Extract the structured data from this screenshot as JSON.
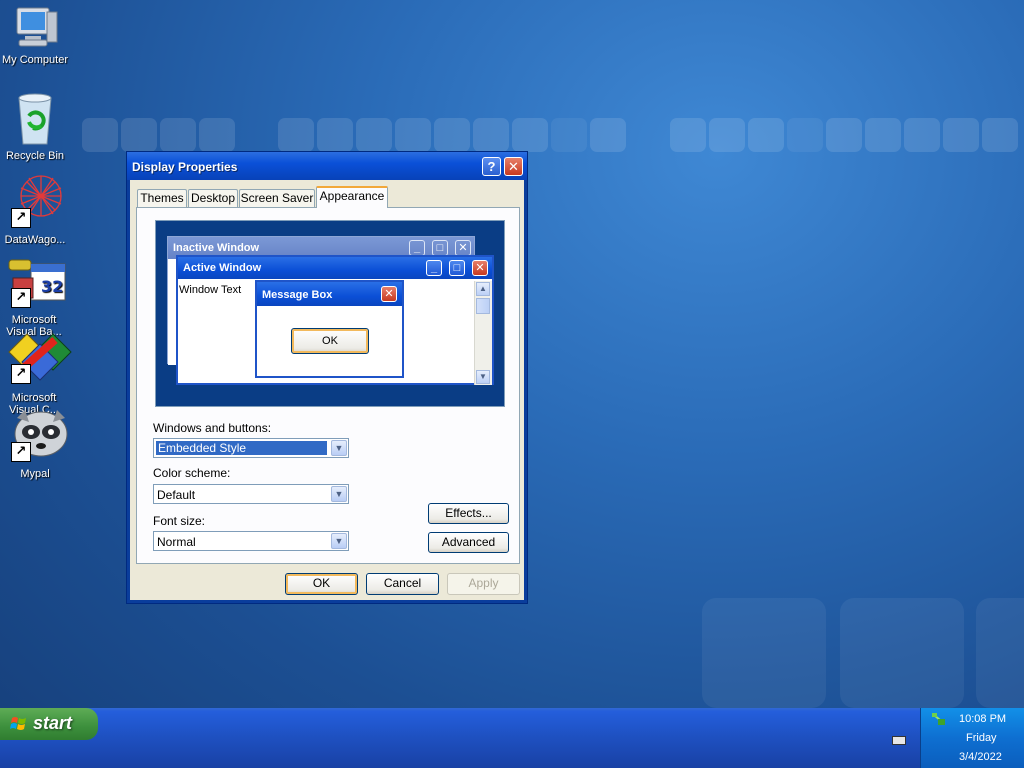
{
  "desktop": {
    "icons": [
      {
        "label": "My Computer"
      },
      {
        "label": "Recycle Bin"
      },
      {
        "label": "DataWago..."
      },
      {
        "label": "Microsoft Visual Ba..."
      },
      {
        "label": "Microsoft Visual C..."
      },
      {
        "label": "Mypal"
      }
    ]
  },
  "dialog": {
    "title": "Display Properties",
    "help_glyph": "?",
    "close_glyph": "✕",
    "tabs": [
      {
        "label": "Themes"
      },
      {
        "label": "Desktop"
      },
      {
        "label": "Screen Saver"
      },
      {
        "label": "Appearance"
      }
    ],
    "active_tab": "Appearance",
    "preview": {
      "inactive_title": "Inactive Window",
      "active_title": "Active Window",
      "window_text": "Window Text",
      "message_box_title": "Message Box",
      "message_box_ok": "OK"
    },
    "windows_buttons": {
      "label": "Windows and buttons:",
      "value": "Embedded Style"
    },
    "color_scheme": {
      "label": "Color scheme:",
      "value": "Default"
    },
    "font_size": {
      "label": "Font size:",
      "value": "Normal"
    },
    "effects_label": "Effects...",
    "advanced_label": "Advanced",
    "ok_label": "OK",
    "cancel_label": "Cancel",
    "apply_label": "Apply"
  },
  "taskbar": {
    "start_label": "start",
    "clock": {
      "time": "10:08 PM",
      "day": "Friday",
      "date": "3/4/2022"
    }
  },
  "colors": {
    "desktop": "#2a6bb7",
    "titlebar": "#0a50d8",
    "dialog_face": "#ece9d8",
    "active_tab_accent": "#f2a83a",
    "close_button": "#c73a20",
    "selection": "#316ac5",
    "start_button": "#3c8f3c",
    "tray": "#0e6fd1"
  }
}
